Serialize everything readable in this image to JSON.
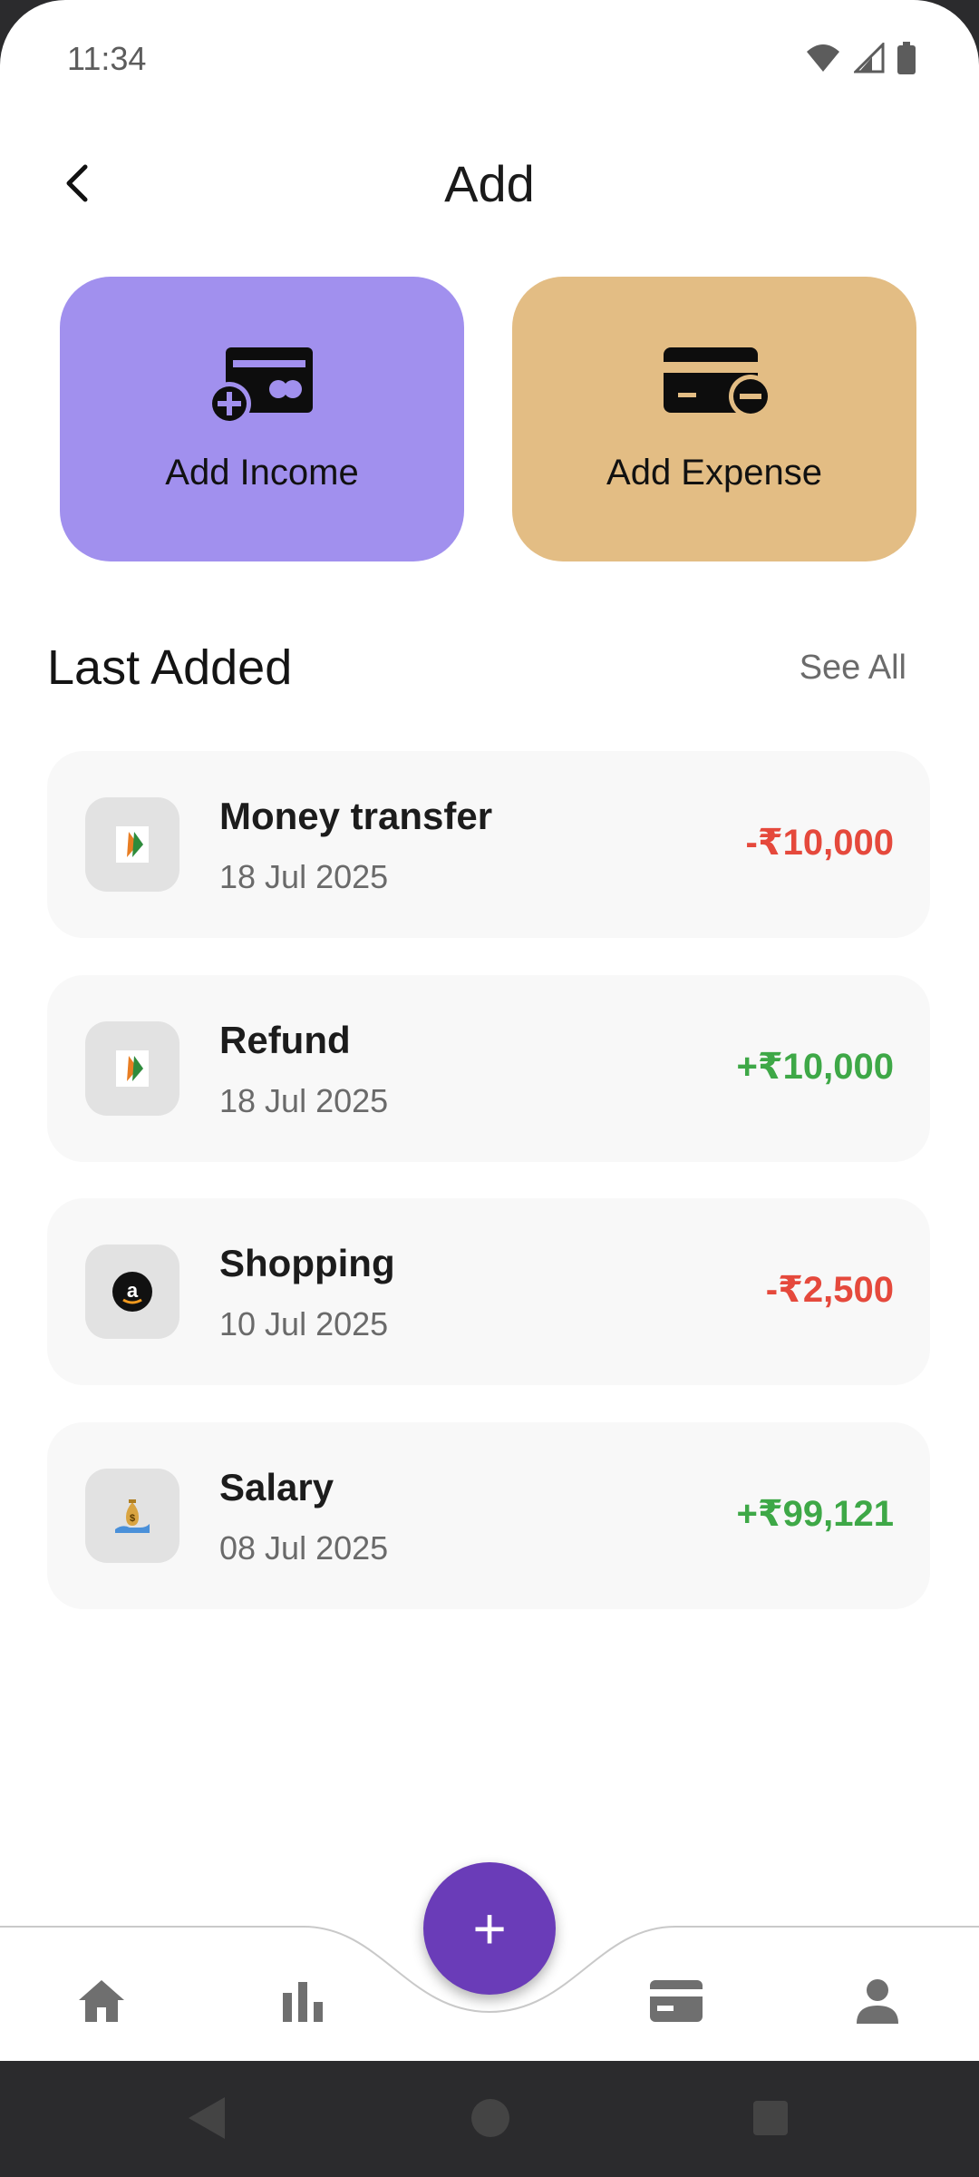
{
  "status_bar": {
    "time": "11:34"
  },
  "header": {
    "title": "Add"
  },
  "actions": {
    "income_label": "Add Income",
    "expense_label": "Add Expense"
  },
  "section": {
    "title": "Last Added",
    "see_all": "See All"
  },
  "transactions": [
    {
      "title": "Money transfer",
      "date": "18 Jul 2025",
      "amount": "-₹10,000",
      "icon": "upi-icon"
    },
    {
      "title": "Refund",
      "date": "18 Jul 2025",
      "amount": "+₹10,000",
      "icon": "upi-icon"
    },
    {
      "title": "Shopping",
      "date": "10 Jul 2025",
      "amount": "-₹2,500",
      "icon": "amazon-icon"
    },
    {
      "title": "Salary",
      "date": "08 Jul 2025",
      "amount": "+₹99,121",
      "icon": "money-bag-icon"
    }
  ],
  "fab": {
    "label": "+"
  },
  "colors": {
    "income_card": "#a190ee",
    "expense_card": "#e3bd84",
    "negative": "#e5493c",
    "positive": "#3ea847",
    "fab": "#6a3cb8"
  },
  "nav": [
    "home-icon",
    "chart-icon",
    "add-button",
    "card-icon",
    "profile-icon"
  ]
}
